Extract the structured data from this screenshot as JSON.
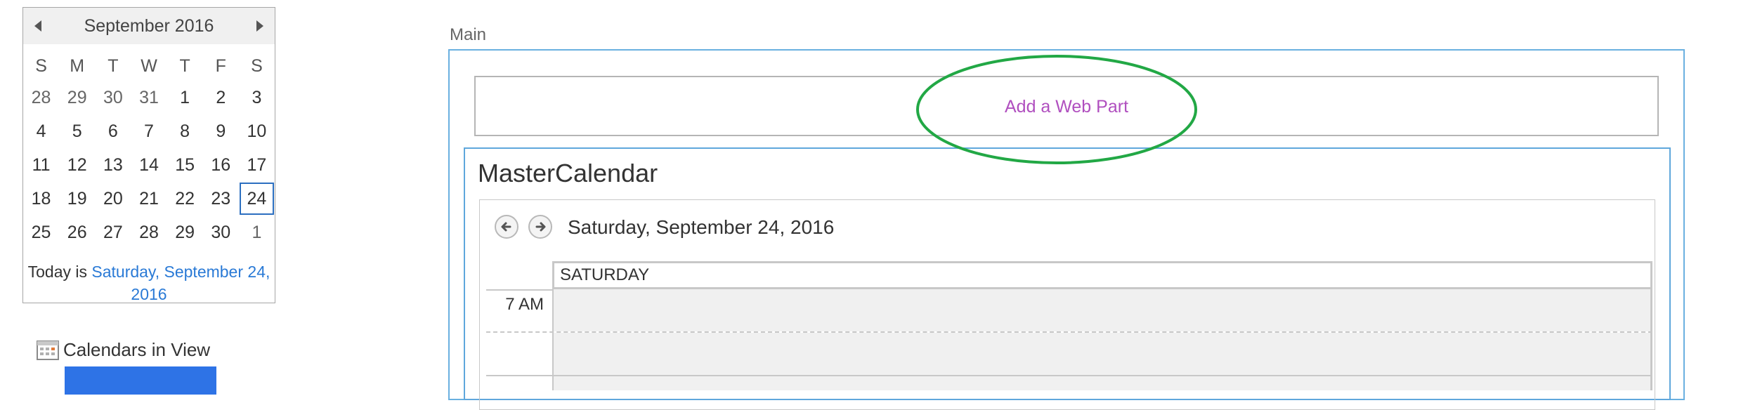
{
  "datepicker": {
    "month_title": "September 2016",
    "weekdays": [
      "S",
      "M",
      "T",
      "W",
      "T",
      "F",
      "S"
    ],
    "weeks": [
      [
        "28",
        "29",
        "30",
        "31",
        "1",
        "2",
        "3"
      ],
      [
        "4",
        "5",
        "6",
        "7",
        "8",
        "9",
        "10"
      ],
      [
        "11",
        "12",
        "13",
        "14",
        "15",
        "16",
        "17"
      ],
      [
        "18",
        "19",
        "20",
        "21",
        "22",
        "23",
        "24"
      ],
      [
        "25",
        "26",
        "27",
        "28",
        "29",
        "30",
        "1"
      ]
    ],
    "selected_day": "24",
    "today_prefix": "Today is",
    "today_link": "Saturday, September 24, 2016"
  },
  "calendars_in_view": {
    "label": "Calendars in View",
    "icon": "calendar-grid-icon",
    "selected_color": "#2e73e6"
  },
  "zone": {
    "label": "Main",
    "add_web_part": "Add a Web Part",
    "highlight_color": "#22a845"
  },
  "webpart": {
    "title": "MasterCalendar",
    "current_date": "Saturday, September 24, 2016",
    "day_header": "SATURDAY",
    "time_labels": [
      "7 AM"
    ],
    "nav_icons": [
      "arrow-left-icon",
      "arrow-right-icon"
    ]
  },
  "colors": {
    "link": "#2a7ad6",
    "add_web_part_text": "#b04fbf",
    "zone_border": "#6ab0e0",
    "slot_bg": "#f0f0f0"
  }
}
